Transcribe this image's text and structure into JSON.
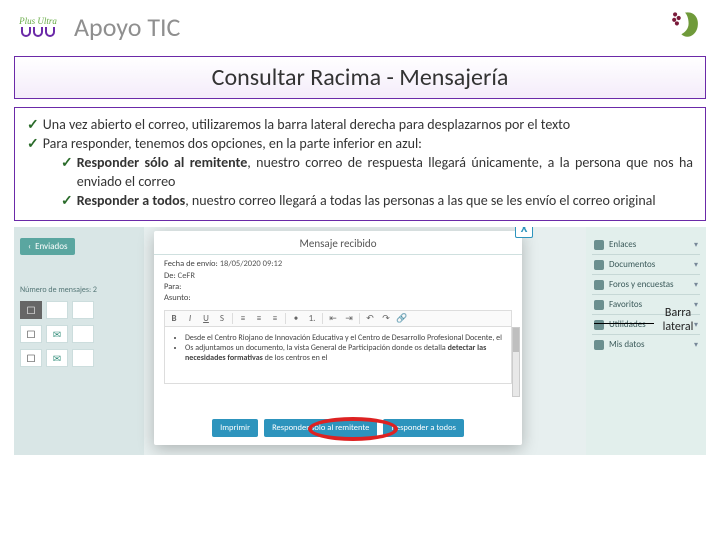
{
  "header": {
    "apoyo": "Apoyo TIC",
    "logo_left_text": "Plus Ultra"
  },
  "subtitle": "Consultar Racima - Mensajería",
  "content": {
    "p1": "Una vez abierto el correo, utilizaremos la barra lateral derecha para desplazarnos por el texto",
    "p2": "Para responder, tenemos dos opciones, en la parte inferior en azul:",
    "s1_b": "Responder sólo al remitente",
    "s1_r": ", nuestro correo de respuesta llegará únicamente, a la persona que nos ha enviado el correo",
    "s2_b": "Responder a todos",
    "s2_r": ", nuestro correo llegará a todas las personas a las que se les envío el correo original"
  },
  "screenshot": {
    "left": {
      "back": "Enviados",
      "count": "Número de mensajes: 2"
    },
    "right_panel": [
      "Enlaces",
      "Documentos",
      "Foros y encuestas",
      "Favoritos",
      "Utilidades",
      "Mis datos"
    ],
    "modal": {
      "title": "Mensaje recibido",
      "line1_lbl": "Fecha de envío:",
      "line1_val": "18/05/2020 09:12",
      "line2_lbl": "De:",
      "line2_val": "CeFR",
      "line3_lbl": "Para:",
      "line4_lbl": "Asunto:",
      "editor_li1": "Desde el Centro Riojano de Innovación Educativa y el Centro de Desarrollo Profesional Docente, el",
      "editor_li2": "Os adjuntamos un documento, la vista General de Participación donde os detalla",
      "editor_bold": "detectar las necesidades formativas",
      "editor_tail": " de los centros en el",
      "btn_print": "Imprimir",
      "btn_reply_sender": "Responder sólo al remitente",
      "btn_reply_all": "Responder a todos"
    },
    "annotation": "Barra lateral"
  }
}
